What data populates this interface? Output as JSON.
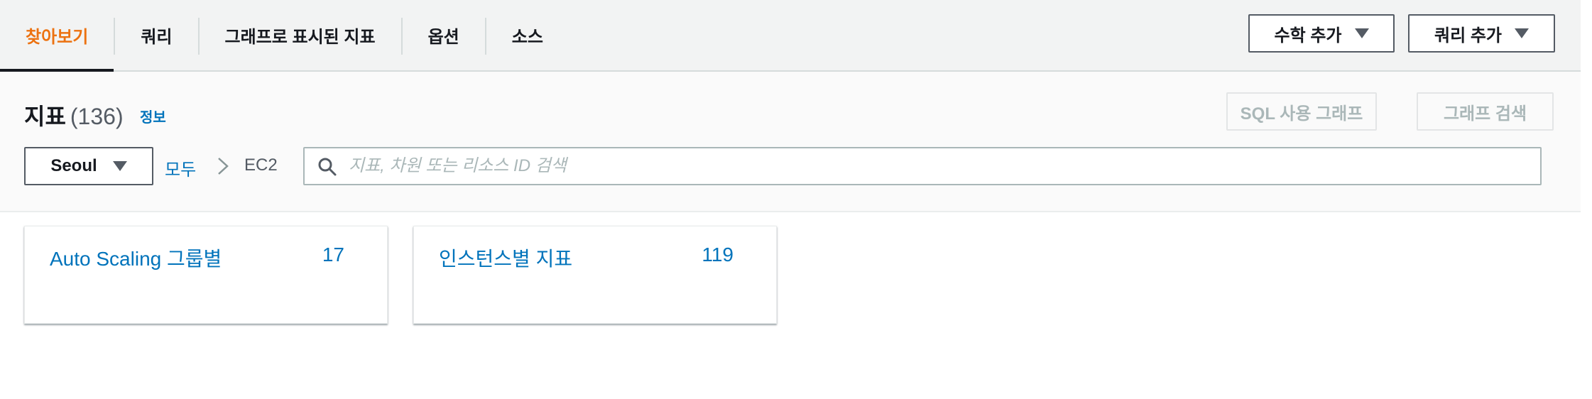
{
  "tabs": [
    {
      "label": "찾아보기",
      "active": true
    },
    {
      "label": "쿼리",
      "active": false
    },
    {
      "label": "그래프로 표시된 지표",
      "active": false
    },
    {
      "label": "옵션",
      "active": false
    },
    {
      "label": "소스",
      "active": false
    }
  ],
  "toolbar": {
    "math_label": "수학 추가",
    "query_label": "쿼리 추가"
  },
  "panel": {
    "title": "지표",
    "count": "(136)",
    "info_link": "정보",
    "sql_graph_label": "SQL 사용 그래프",
    "graph_search_label": "그래프 검색"
  },
  "filter": {
    "region": "Seoul",
    "breadcrumb_all": "모두",
    "breadcrumb_current": "EC2",
    "search_placeholder": "지표, 차원 또는 리소스 ID 검색",
    "search_value": ""
  },
  "cards": [
    {
      "label": "Auto Scaling 그룹별",
      "count": "17"
    },
    {
      "label": "인스턴스별 지표",
      "count": "119"
    }
  ],
  "colors": {
    "accent_active_tab": "#ec7211",
    "link": "#0073bb",
    "disabled_text": "#aab7b8"
  }
}
